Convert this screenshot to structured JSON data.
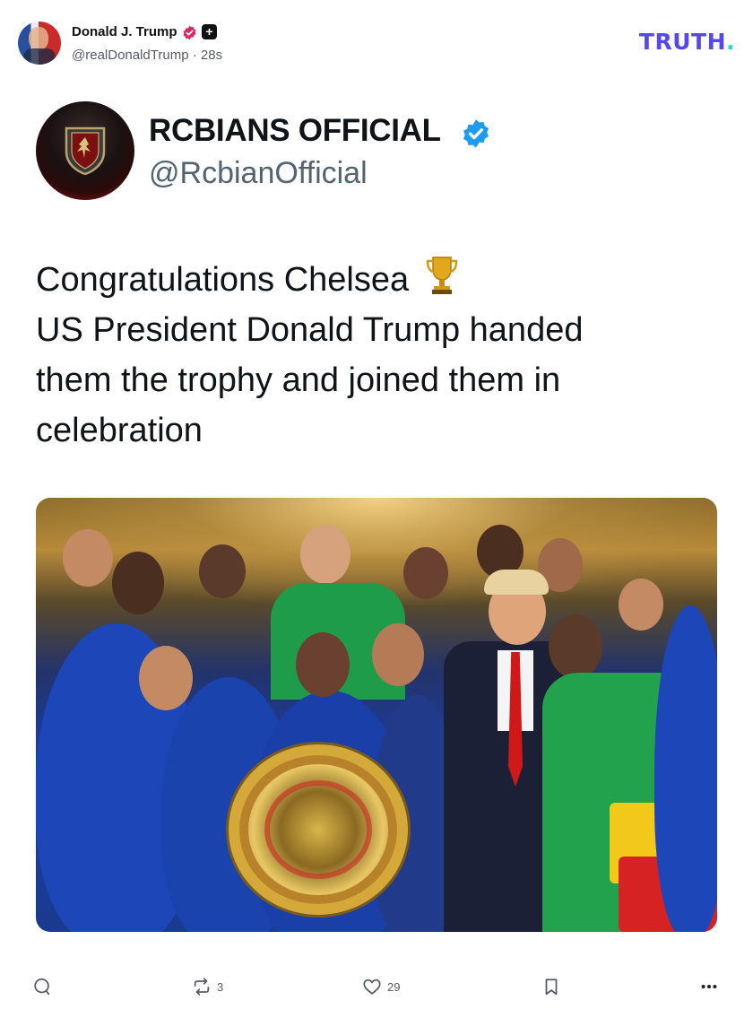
{
  "post": {
    "author_name": "Donald J. Trump",
    "author_handle": "@realDonaldTrump",
    "separator": "·",
    "time_ago": "28s",
    "brand_logo_text": "TRUTH",
    "brand_logo_dot": "."
  },
  "embedded_tweet": {
    "name": "RCBIANS OFFICIAL",
    "handle": "@RcbianOfficial",
    "text_lines": [
      "Congratulations Chelsea",
      "US President Donald Trump handed",
      "them the trophy and joined them in",
      "celebration"
    ],
    "photo_alt": ""
  },
  "actions": {
    "reply_count": "",
    "retruth_count": "3",
    "like_count": "29",
    "save_count": ""
  },
  "colors": {
    "brand": "#5448ee",
    "brand_dot": "#17e2c7",
    "verified_blue": "#1d9bf0",
    "verified_pink": "#e0245e"
  },
  "icons": [
    "reply-icon",
    "retruth-icon",
    "like-icon",
    "bookmark-icon",
    "more-icon",
    "verified-icon",
    "plus-badge-icon",
    "trophy-icon"
  ]
}
